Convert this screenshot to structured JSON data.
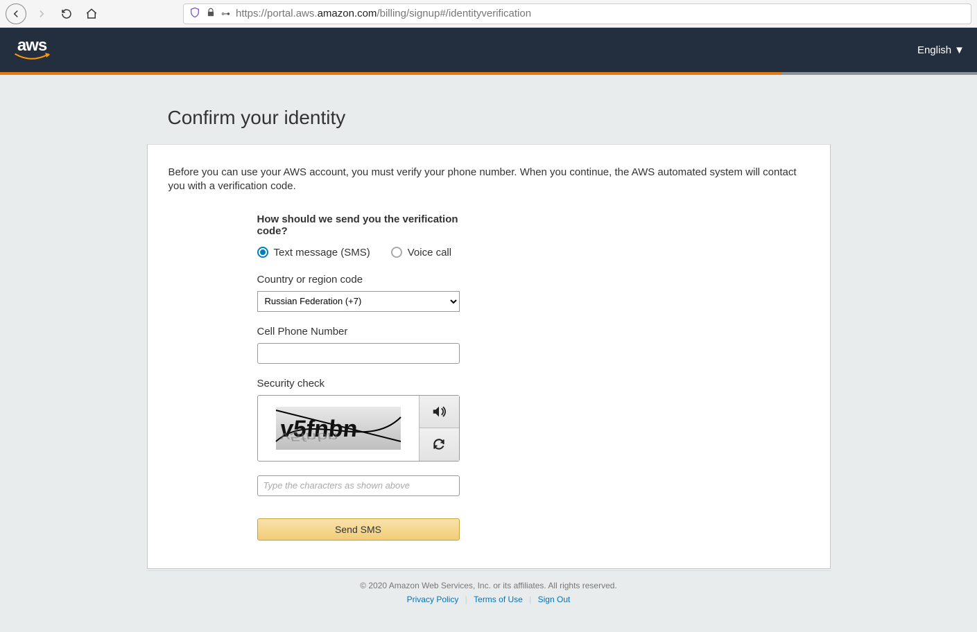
{
  "browser": {
    "url_pre": "https://portal.aws.",
    "url_em": "amazon.com",
    "url_post": "/billing/signup#/identityverification"
  },
  "nav": {
    "language": "English"
  },
  "page": {
    "title": "Confirm your identity",
    "intro": "Before you can use your AWS account, you must verify your phone number. When you continue, the AWS automated system will contact you with a verification code."
  },
  "form": {
    "question": "How should we send you the verification code?",
    "option_sms": "Text message (SMS)",
    "option_voice": "Voice call",
    "country_label": "Country or region code",
    "country_value": "Russian Federation (+7)",
    "phone_label": "Cell Phone Number",
    "phone_value": "",
    "security_label": "Security check",
    "captcha_placeholder": "Type the characters as shown above",
    "captcha_value": "",
    "submit": "Send SMS"
  },
  "footer": {
    "copyright": "© 2020 Amazon Web Services, Inc. or its affiliates. All rights reserved.",
    "privacy": "Privacy Policy",
    "terms": "Terms of Use",
    "signout": "Sign Out"
  }
}
